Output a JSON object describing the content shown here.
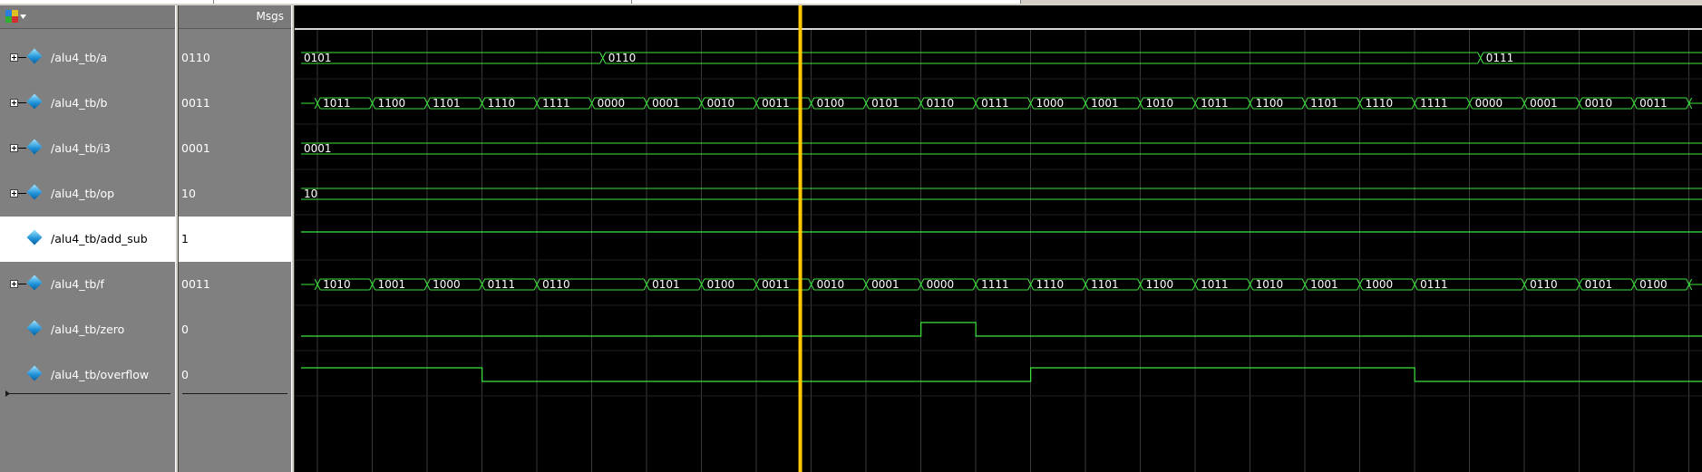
{
  "header": {
    "msgs_label": "Msgs",
    "menu_icon": "wave-window-menu-icon"
  },
  "colors": {
    "wave": "#3ee63e",
    "cursor": "#ffc800",
    "grid": "#3a3a3a",
    "selected_row": "#ffffff"
  },
  "signals": [
    {
      "name": "/alu4_tb/a",
      "value": "0110",
      "bus": true
    },
    {
      "name": "/alu4_tb/b",
      "value": "0011",
      "bus": true
    },
    {
      "name": "/alu4_tb/i3",
      "value": "0001",
      "bus": true
    },
    {
      "name": "/alu4_tb/op",
      "value": "10",
      "bus": true
    },
    {
      "name": "/alu4_tb/add_sub",
      "value": "1",
      "bus": false,
      "selected": true
    },
    {
      "name": "/alu4_tb/f",
      "value": "0011",
      "bus": true
    },
    {
      "name": "/alu4_tb/zero",
      "value": "0",
      "bus": false
    },
    {
      "name": "/alu4_tb/overflow",
      "value": "0",
      "bus": false
    }
  ],
  "waves": {
    "a": [
      {
        "t": 0,
        "v": "0101"
      },
      {
        "t": 5.5,
        "v": "0110"
      },
      {
        "t": 21.5,
        "v": "0111"
      }
    ],
    "b": [
      {
        "t": 0,
        "v": ""
      },
      {
        "t": 0.3,
        "v": "1011"
      },
      {
        "t": 1.3,
        "v": "1100"
      },
      {
        "t": 2.3,
        "v": "1101"
      },
      {
        "t": 3.3,
        "v": "1110"
      },
      {
        "t": 4.3,
        "v": "1111"
      },
      {
        "t": 5.3,
        "v": "0000"
      },
      {
        "t": 6.3,
        "v": "0001"
      },
      {
        "t": 7.3,
        "v": "0010"
      },
      {
        "t": 8.3,
        "v": "0011"
      },
      {
        "t": 9.3,
        "v": "0100"
      },
      {
        "t": 10.3,
        "v": "0101"
      },
      {
        "t": 11.3,
        "v": "0110"
      },
      {
        "t": 12.3,
        "v": "0111"
      },
      {
        "t": 13.3,
        "v": "1000"
      },
      {
        "t": 14.3,
        "v": "1001"
      },
      {
        "t": 15.3,
        "v": "1010"
      },
      {
        "t": 16.3,
        "v": "1011"
      },
      {
        "t": 17.3,
        "v": "1100"
      },
      {
        "t": 18.3,
        "v": "1101"
      },
      {
        "t": 19.3,
        "v": "1110"
      },
      {
        "t": 20.3,
        "v": "1111"
      },
      {
        "t": 21.3,
        "v": "0000"
      },
      {
        "t": 22.3,
        "v": "0001"
      },
      {
        "t": 23.3,
        "v": "0010"
      },
      {
        "t": 24.3,
        "v": "0011"
      },
      {
        "t": 25.3,
        "v": ""
      }
    ],
    "i3": [
      {
        "t": 0,
        "v": "0001"
      }
    ],
    "op": [
      {
        "t": 0,
        "v": "10"
      }
    ],
    "f": [
      {
        "t": 0,
        "v": ""
      },
      {
        "t": 0.3,
        "v": "1010"
      },
      {
        "t": 1.3,
        "v": "1001"
      },
      {
        "t": 2.3,
        "v": "1000"
      },
      {
        "t": 3.3,
        "v": "0111"
      },
      {
        "t": 4.3,
        "v": "0110"
      },
      {
        "t": 6.3,
        "v": "0101"
      },
      {
        "t": 7.3,
        "v": "0100"
      },
      {
        "t": 8.3,
        "v": "0011"
      },
      {
        "t": 9.3,
        "v": "0010"
      },
      {
        "t": 10.3,
        "v": "0001"
      },
      {
        "t": 11.3,
        "v": "0000"
      },
      {
        "t": 12.3,
        "v": "1111"
      },
      {
        "t": 13.3,
        "v": "1110"
      },
      {
        "t": 14.3,
        "v": "1101"
      },
      {
        "t": 15.3,
        "v": "1100"
      },
      {
        "t": 16.3,
        "v": "1011"
      },
      {
        "t": 17.3,
        "v": "1010"
      },
      {
        "t": 18.3,
        "v": "1001"
      },
      {
        "t": 19.3,
        "v": "1000"
      },
      {
        "t": 20.3,
        "v": "0111"
      },
      {
        "t": 22.3,
        "v": "0110"
      },
      {
        "t": 23.3,
        "v": "0101"
      },
      {
        "t": 24.3,
        "v": "0100"
      },
      {
        "t": 25.3,
        "v": ""
      }
    ],
    "add_sub": [
      {
        "t": 0,
        "v": 1
      }
    ],
    "zero": [
      {
        "t": 0,
        "v": 0
      },
      {
        "t": 11.3,
        "v": 1
      },
      {
        "t": 12.3,
        "v": 0
      }
    ],
    "overflow": [
      {
        "t": 0,
        "v": 1
      },
      {
        "t": 3.3,
        "v": 0
      },
      {
        "t": 13.3,
        "v": 1
      },
      {
        "t": 20.3,
        "v": 0
      }
    ]
  },
  "cursor_time": 9.1,
  "time_span": 25.6
}
